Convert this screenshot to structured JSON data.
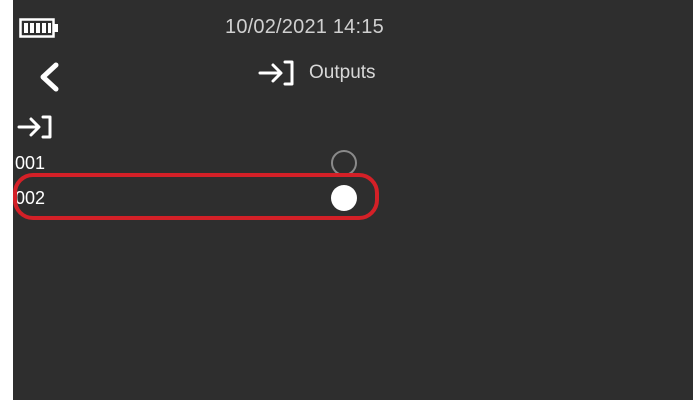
{
  "status_bar": {
    "battery_icon": "battery-full-icon",
    "datetime": "10/02/2021  14:15"
  },
  "header": {
    "back_icon": "chevron-left-icon",
    "title_icon": "output-arrow-icon",
    "title": "Outputs"
  },
  "section": {
    "icon": "output-arrow-icon"
  },
  "outputs": [
    {
      "label": "001",
      "selected": false
    },
    {
      "label": "002",
      "selected": true
    }
  ],
  "colors": {
    "background": "#2e2e2e",
    "text": "#ffffff",
    "radio_off_border": "#8a8a8a",
    "highlight": "#d42027"
  }
}
